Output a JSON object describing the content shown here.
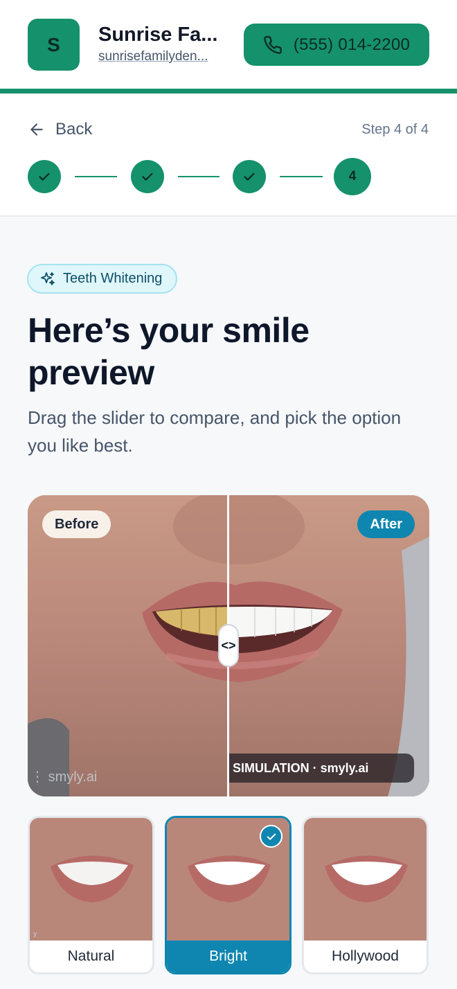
{
  "header": {
    "logo_letter": "S",
    "practice_name": "Sunrise Fa...",
    "practice_url": "sunrisefamilyden...",
    "phone_label": "(555) 014-2200",
    "icon": "phone-icon"
  },
  "nav": {
    "back_label": "Back",
    "step_text": "Step 4 of 4",
    "current_step_number": "4",
    "completed_steps": 3,
    "total_steps": 4
  },
  "content": {
    "badge_label": "Teeth Whitening",
    "title": "Here’s your smile preview",
    "subtitle": "Drag the slider to compare, and pick the option you like best."
  },
  "compare": {
    "before_label": "Before",
    "after_label": "After",
    "handle_glyph": "<>",
    "simulation_label": "ILE SIMULATION · smyly.ai",
    "watermark": "smyly.ai",
    "slider_position": 0.5
  },
  "options": [
    {
      "label": "Natural",
      "selected": false
    },
    {
      "label": "Bright",
      "selected": true
    },
    {
      "label": "Hollywood",
      "selected": false
    }
  ],
  "colors": {
    "brand_green": "#15916b",
    "accent_blue": "#0e86b0",
    "badge_bg": "#dff6fb"
  }
}
